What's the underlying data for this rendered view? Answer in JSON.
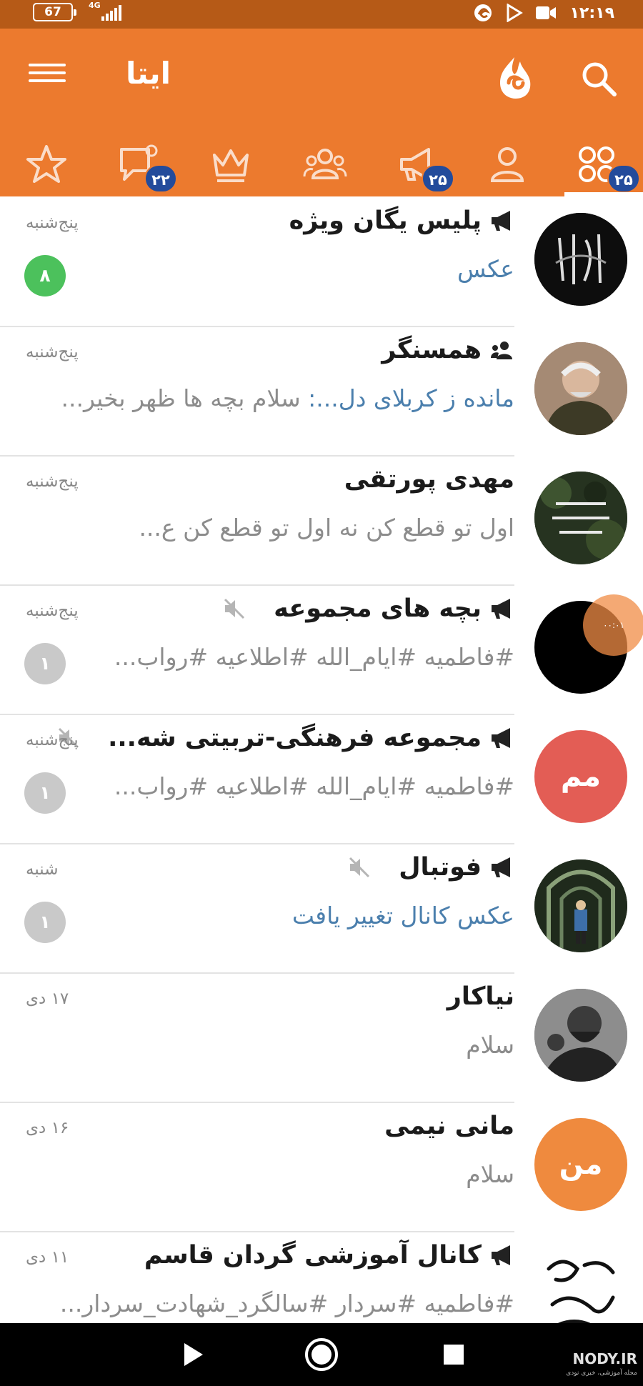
{
  "status_bar": {
    "battery": "67",
    "network_type": "4G",
    "time": "۱۲:۱۹",
    "icons": [
      "eitaa-icon",
      "play-store-icon",
      "video-record-icon"
    ]
  },
  "header": {
    "title": "ایتا",
    "color": "#ec7a2e",
    "menu_icon": "hamburger-menu-icon",
    "logo_icon": "eitaa-logo-icon",
    "search_icon": "search-icon"
  },
  "tabs": [
    {
      "name": "all-chats",
      "icon": "grid-icon",
      "badge": "۲۵",
      "active": true
    },
    {
      "name": "private",
      "icon": "person-icon",
      "badge": null
    },
    {
      "name": "channels",
      "icon": "megaphone-icon",
      "badge": "۲۵"
    },
    {
      "name": "groups",
      "icon": "group-icon",
      "badge": null
    },
    {
      "name": "bots",
      "icon": "crown-icon",
      "badge": null
    },
    {
      "name": "unread",
      "icon": "chat-bubble-icon",
      "badge": "۲۲"
    },
    {
      "name": "favorites",
      "icon": "star-icon",
      "badge": null
    }
  ],
  "chats": [
    {
      "name": "پلیس یگان ویژه",
      "kind": "channel",
      "muted": false,
      "time": "پنج‌شنبه",
      "preview": "عکس",
      "preview_style": "accent",
      "unread": "۸",
      "unread_style": "green"
    },
    {
      "name": "همسنگر",
      "kind": "group",
      "muted": false,
      "time": "پنج‌شنبه",
      "sender": "مانده ز کربلای دل...:",
      "preview": " سلام بچه ها ظهر بخیر...",
      "preview_style": "normal",
      "unread": null
    },
    {
      "name": "مهدی پورتقی",
      "kind": "user",
      "muted": false,
      "time": "پنج‌شنبه",
      "preview": "اول تو قطع کن    نه اول تو قطع کن         ع...",
      "preview_style": "normal",
      "unread": null
    },
    {
      "name": "بچه های مجموعه",
      "kind": "channel",
      "muted": true,
      "time": "پنج‌شنبه",
      "preview": "#فاطمیه #ایام_الله #اطلاعیه #رواب...",
      "preview_style": "normal",
      "unread": "۱",
      "unread_style": "gray"
    },
    {
      "name": "مجموعه فرهنگی-تربیتی شه...",
      "kind": "channel",
      "muted": true,
      "time": "پنج‌شنبه",
      "preview": "#فاطمیه #ایام_الله #اطلاعیه #رواب...",
      "preview_style": "normal",
      "unread": "۱",
      "unread_style": "gray",
      "avatar_text": "مم",
      "avatar_color": "#e35d55"
    },
    {
      "name": "فوتبال",
      "kind": "channel",
      "muted": true,
      "time": "شنبه",
      "preview": "عکس کانال تغییر یافت",
      "preview_style": "accent",
      "unread": "۱",
      "unread_style": "gray"
    },
    {
      "name": "نیاکار",
      "kind": "user",
      "muted": false,
      "time": "۱۷ دی",
      "preview": "سلام",
      "preview_style": "normal",
      "unread": null
    },
    {
      "name": "مانی نیمی",
      "kind": "user",
      "muted": false,
      "time": "۱۶ دی",
      "preview": "سلام",
      "preview_style": "normal",
      "unread": null,
      "avatar_text": "من",
      "avatar_color": "#ef8a3e"
    },
    {
      "name": "کانال آموزشی گردان قاسم",
      "kind": "channel",
      "muted": false,
      "time": "۱۱ دی",
      "preview": "#فاطمیه #سردار #سالگرد_شهادت_سردار...",
      "preview_style": "normal",
      "unread": null
    }
  ],
  "floating_bubble": "۰۰:۰۱",
  "watermark": {
    "title": "NODY.IR",
    "subtitle": "مجله آموزشی، خبری نودی"
  }
}
